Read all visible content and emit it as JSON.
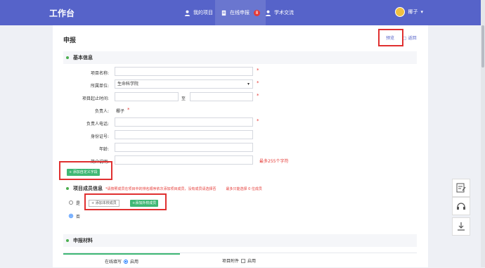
{
  "header": {
    "brand": "工作台",
    "nav": [
      {
        "label": "我的项目",
        "icon": "person-icon"
      },
      {
        "label": "在线申报",
        "icon": "document-icon",
        "badge": "8"
      },
      {
        "label": "学术交流",
        "icon": "people-icon"
      }
    ],
    "user": "椰子"
  },
  "page": {
    "title": "申报",
    "preview": "预览",
    "back": "返回"
  },
  "basic": {
    "title": "基本信息",
    "fields": {
      "name_label": "项目名称:",
      "unit_label": "所属单位:",
      "unit_value": "生命科学院",
      "period_label": "项目起止时间:",
      "period_sep": "至",
      "owner_label": "负责人:",
      "owner_value": "椰子",
      "phone_label": "负责人电话:",
      "id_label": "身份证号:",
      "age_label": "年龄:",
      "intro_label": "简介说明:",
      "intro_limit": "最多255个字符"
    },
    "add_custom": "+ 添加自定义字段"
  },
  "members": {
    "title": "项目成员信息",
    "note": "*请按照成员在项目中的排名顺序依次添加项目成员，没有成员请选择否",
    "limit_note": "最多只能选择 0 位成员",
    "yes": "是",
    "no": "否",
    "add_internal": "+ 添加本校成员",
    "add_external": "+添加外校成员"
  },
  "materials": {
    "title": "申报材料",
    "tab_online": "在线填写",
    "tab_online_opt": "启用",
    "tab_attach": "项目附件",
    "tab_attach_opt": "启用"
  },
  "colors": {
    "primary": "#5663c9",
    "green": "#3fb875",
    "red": "#e53935"
  }
}
